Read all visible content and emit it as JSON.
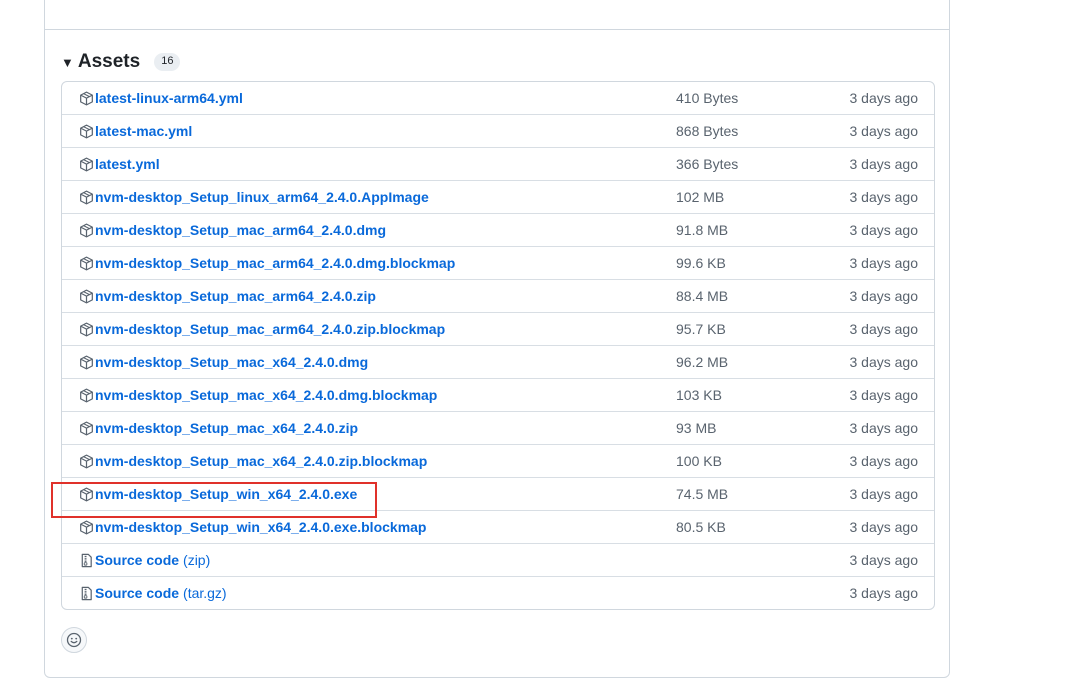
{
  "assets": {
    "title": "Assets",
    "count": "16",
    "items": [
      {
        "name": "latest-linux-arm64.yml",
        "size": "410 Bytes",
        "date": "3 days ago",
        "icon": "package-icon"
      },
      {
        "name": "latest-mac.yml",
        "size": "868 Bytes",
        "date": "3 days ago",
        "icon": "package-icon"
      },
      {
        "name": "latest.yml",
        "size": "366 Bytes",
        "date": "3 days ago",
        "icon": "package-icon"
      },
      {
        "name": "nvm-desktop_Setup_linux_arm64_2.4.0.AppImage",
        "size": "102 MB",
        "date": "3 days ago",
        "icon": "package-icon"
      },
      {
        "name": "nvm-desktop_Setup_mac_arm64_2.4.0.dmg",
        "size": "91.8 MB",
        "date": "3 days ago",
        "icon": "package-icon"
      },
      {
        "name": "nvm-desktop_Setup_mac_arm64_2.4.0.dmg.blockmap",
        "size": "99.6 KB",
        "date": "3 days ago",
        "icon": "package-icon"
      },
      {
        "name": "nvm-desktop_Setup_mac_arm64_2.4.0.zip",
        "size": "88.4 MB",
        "date": "3 days ago",
        "icon": "package-icon"
      },
      {
        "name": "nvm-desktop_Setup_mac_arm64_2.4.0.zip.blockmap",
        "size": "95.7 KB",
        "date": "3 days ago",
        "icon": "package-icon"
      },
      {
        "name": "nvm-desktop_Setup_mac_x64_2.4.0.dmg",
        "size": "96.2 MB",
        "date": "3 days ago",
        "icon": "package-icon"
      },
      {
        "name": "nvm-desktop_Setup_mac_x64_2.4.0.dmg.blockmap",
        "size": "103 KB",
        "date": "3 days ago",
        "icon": "package-icon"
      },
      {
        "name": "nvm-desktop_Setup_mac_x64_2.4.0.zip",
        "size": "93 MB",
        "date": "3 days ago",
        "icon": "package-icon"
      },
      {
        "name": "nvm-desktop_Setup_mac_x64_2.4.0.zip.blockmap",
        "size": "100 KB",
        "date": "3 days ago",
        "icon": "package-icon"
      },
      {
        "name": "nvm-desktop_Setup_win_x64_2.4.0.exe",
        "size": "74.5 MB",
        "date": "3 days ago",
        "icon": "package-icon"
      },
      {
        "name": "nvm-desktop_Setup_win_x64_2.4.0.exe.blockmap",
        "size": "80.5 KB",
        "date": "3 days ago",
        "icon": "package-icon"
      },
      {
        "name": "Source code",
        "suffix": "(zip)",
        "size": "",
        "date": "3 days ago",
        "icon": "file-zip-icon"
      },
      {
        "name": "Source code",
        "suffix": "(tar.gz)",
        "size": "",
        "date": "3 days ago",
        "icon": "file-zip-icon"
      }
    ]
  },
  "colors": {
    "link": "#0969da",
    "muted": "#59636e",
    "border": "#d0d7de",
    "highlight": "#e0312a"
  }
}
